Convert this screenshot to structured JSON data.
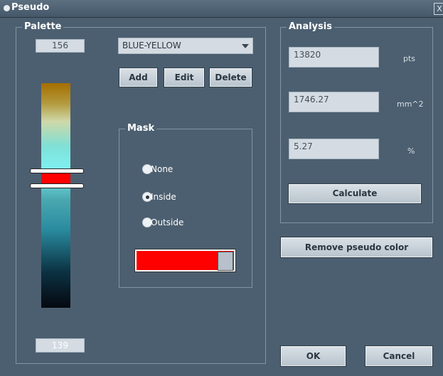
{
  "window": {
    "title": "Pseudo",
    "close_glyph": "X"
  },
  "palette": {
    "legend": "Palette",
    "top_value": "156",
    "bottom_value": "139",
    "colormap": {
      "selected": "BLUE-YELLOW"
    },
    "buttons": {
      "add": "Add",
      "edit": "Edit",
      "delete": "Delete"
    },
    "bar_colors": {
      "top": "#a56d00",
      "upper_mid": "#7fe0d6",
      "highlight": "#ff0000",
      "lower": "#2a8ca0",
      "bottom": "#050810"
    }
  },
  "mask": {
    "legend": "Mask",
    "options": [
      "None",
      "Inside",
      "Outside"
    ],
    "selected": "Inside",
    "color": "#ff0000"
  },
  "analysis": {
    "legend": "Analysis",
    "rows": [
      {
        "value": "13820",
        "unit": "pts"
      },
      {
        "value": "1746.27",
        "unit": "mm^2"
      },
      {
        "value": "5.27",
        "unit": "%"
      }
    ],
    "calculate_label": "Calculate"
  },
  "actions": {
    "remove_label": "Remove pseudo color",
    "ok_label": "OK",
    "cancel_label": "Cancel"
  }
}
